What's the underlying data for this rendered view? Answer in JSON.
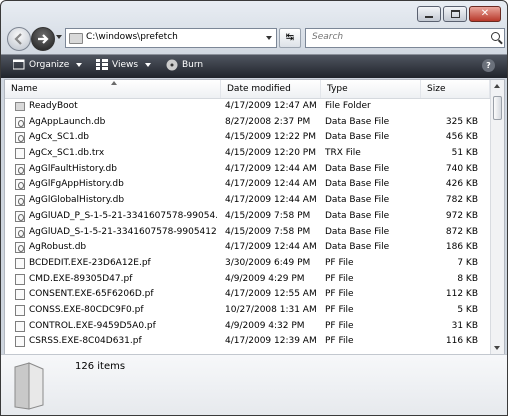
{
  "window": {
    "controls": [
      "minimize",
      "maximize",
      "close"
    ]
  },
  "nav": {
    "address": "C:\\windows\\prefetch",
    "search_placeholder": "Search"
  },
  "toolbar": {
    "organize_label": "Organize",
    "views_label": "Views",
    "burn_label": "Burn"
  },
  "columns": {
    "name": "Name",
    "date": "Date modified",
    "type": "Type",
    "size": "Size"
  },
  "files": [
    {
      "name": "ReadyBoot",
      "date": "4/17/2009 12:47 AM",
      "type": "File Folder",
      "size": "",
      "icon": "folder"
    },
    {
      "name": "AgAppLaunch.db",
      "date": "8/27/2008 2:37 PM",
      "type": "Data Base File",
      "size": "325 KB",
      "icon": "db"
    },
    {
      "name": "AgCx_SC1.db",
      "date": "4/15/2009 12:22 PM",
      "type": "Data Base File",
      "size": "456 KB",
      "icon": "db"
    },
    {
      "name": "AgCx_SC1.db.trx",
      "date": "4/15/2009 12:20 PM",
      "type": "TRX File",
      "size": "51 KB",
      "icon": "file"
    },
    {
      "name": "AgGlFaultHistory.db",
      "date": "4/17/2009 12:44 AM",
      "type": "Data Base File",
      "size": "740 KB",
      "icon": "db"
    },
    {
      "name": "AgGlFgAppHistory.db",
      "date": "4/17/2009 12:44 AM",
      "type": "Data Base File",
      "size": "426 KB",
      "icon": "db"
    },
    {
      "name": "AgGlGlobalHistory.db",
      "date": "4/17/2009 12:44 AM",
      "type": "Data Base File",
      "size": "782 KB",
      "icon": "db"
    },
    {
      "name": "AgGlUAD_P_S-1-5-21-3341607578-99054...",
      "date": "4/15/2009 7:58 PM",
      "type": "Data Base File",
      "size": "972 KB",
      "icon": "db"
    },
    {
      "name": "AgGlUAD_S-1-5-21-3341607578-9905412...",
      "date": "4/15/2009 7:58 PM",
      "type": "Data Base File",
      "size": "872 KB",
      "icon": "db"
    },
    {
      "name": "AgRobust.db",
      "date": "4/17/2009 12:44 AM",
      "type": "Data Base File",
      "size": "186 KB",
      "icon": "db"
    },
    {
      "name": "BCDEDIT.EXE-23D6A12E.pf",
      "date": "3/30/2009 6:49 PM",
      "type": "PF File",
      "size": "7 KB",
      "icon": "file"
    },
    {
      "name": "CMD.EXE-89305D47.pf",
      "date": "4/9/2009 4:29 PM",
      "type": "PF File",
      "size": "8 KB",
      "icon": "file"
    },
    {
      "name": "CONSENT.EXE-65F6206D.pf",
      "date": "4/17/2009 12:55 AM",
      "type": "PF File",
      "size": "112 KB",
      "icon": "file"
    },
    {
      "name": "CONSS.EXE-80CDC9F0.pf",
      "date": "10/27/2008 1:31 AM",
      "type": "PF File",
      "size": "5 KB",
      "icon": "file"
    },
    {
      "name": "CONTROL.EXE-9459D5A0.pf",
      "date": "4/9/2009 4:32 PM",
      "type": "PF File",
      "size": "31 KB",
      "icon": "file"
    },
    {
      "name": "CSRSS.EXE-8C04D631.pf",
      "date": "4/17/2009 12:39 AM",
      "type": "PF File",
      "size": "116 KB",
      "icon": "file"
    }
  ],
  "status": {
    "item_count": "126 items"
  }
}
